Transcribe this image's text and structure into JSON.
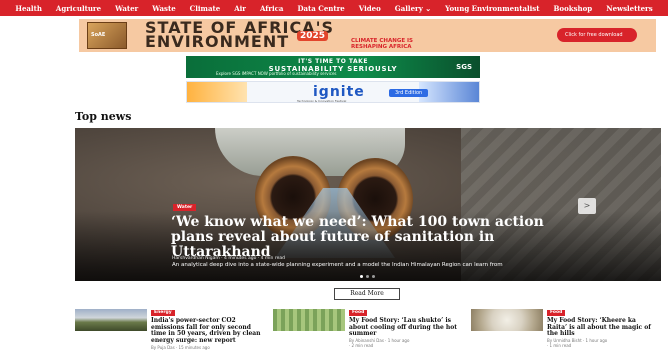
{
  "nav": {
    "items": [
      "Health",
      "Agriculture",
      "Water",
      "Waste",
      "Climate",
      "Air",
      "Africa",
      "Data Centre",
      "Video",
      "Gallery ⌄",
      "Young Environmentalist",
      "Bookshop",
      "Newsletters"
    ]
  },
  "banner_soae": {
    "book_label": "SoAE",
    "line1": "STATE OF AFRICA'S",
    "line2": "ENVIRONMENT",
    "year": "2025",
    "tagline": "CLIMATE CHANGE IS RESHAPING AFRICA",
    "cta": "Click for free download"
  },
  "banner_sgs": {
    "line1": "IT'S TIME TO TAKE",
    "line2": "SUSTAINABILITY SERIOUSLY",
    "line3": "Explore SGS IMPACT NOW portfolio of sustainability services",
    "logo": "SGS"
  },
  "banner_ignite": {
    "word": "ignite",
    "edition": "3rd Edition",
    "sub": "Technology & Innovation Festival"
  },
  "section": {
    "title": "Top news"
  },
  "hero": {
    "category": "Water",
    "headline": "‘We know what we need’: What 100 town action plans reveal about future of sanitation in Uttarakhand",
    "meta": "Harshvardhan Nigam · 4 minutes ago · 4 min read",
    "description": "An analytical deep dive into a state-wide planning experiment and a model the Indian Himalayan Region can learn from",
    "next_label": ">"
  },
  "read_more": "Read More",
  "cards": [
    {
      "category": "Energy",
      "title": "India's power-sector CO2 emissions fall for only second time in 50 years, driven by clean energy surge: new report",
      "byline": "By Puja Das · 15 minutes ago",
      "time": ""
    },
    {
      "category": "Food",
      "title": "My Food Story: ‘Lau shukto’ is about cooling off during the hot summer",
      "byline": "By Abinanshi Das · 1 hour ago",
      "time": "· 2 min read"
    },
    {
      "category": "Food",
      "title": "My Food Story: ‘Kheere ka Raita’ is all about the magic of the hills",
      "byline": "By Urmidha Bisht · 1 hour ago",
      "time": "· 1 min read"
    }
  ]
}
